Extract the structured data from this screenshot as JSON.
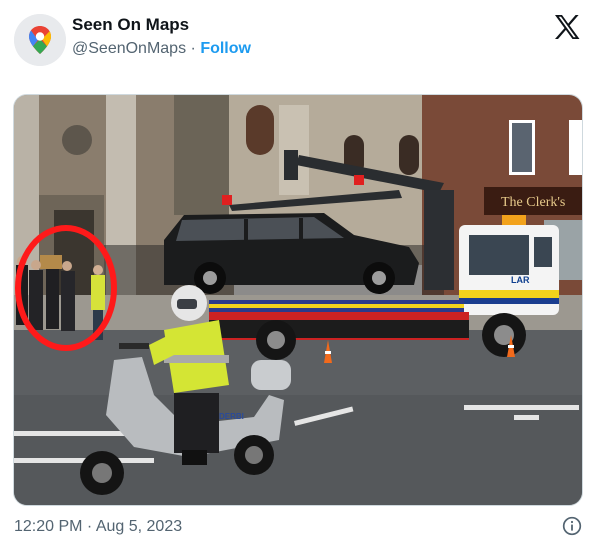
{
  "tweet": {
    "author_name": "Seen On Maps",
    "handle": "@SeenOnMaps",
    "separator": "·",
    "follow_label": "Follow",
    "timestamp": "12:20 PM · Aug 5, 2023"
  },
  "photo": {
    "shop_sign": "The Clerk's",
    "truck_marking": "LAR",
    "scooter_marking": "DERBI"
  },
  "icons": {
    "avatar": "google-maps-pin-icon",
    "platform": "x-logo-icon",
    "info": "info-icon"
  },
  "colors": {
    "follow": "#1d9bf0",
    "highlight_circle": "#ff1a1a",
    "secondary_text": "#536471"
  }
}
